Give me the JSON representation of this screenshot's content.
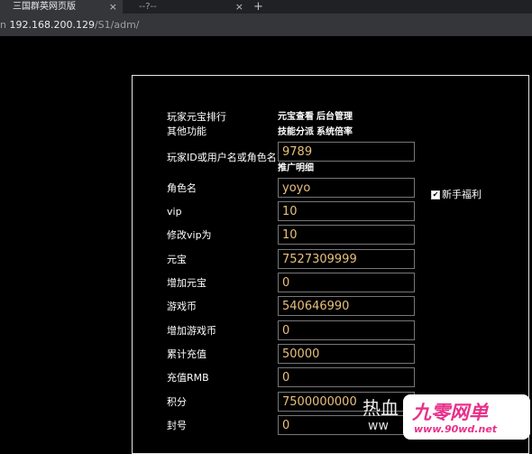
{
  "tabs": [
    {
      "label": "三国群英网页版",
      "close": "×"
    },
    {
      "label": "--?--",
      "close": "×"
    }
  ],
  "new_tab": "+",
  "address": {
    "scheme": "n",
    "host": "192.168.200.129",
    "path": "/S1/adm/"
  },
  "links": {
    "yuanbao_view": "元宝查看",
    "admin": "后台管理",
    "skill_dist": "技能分派",
    "system_rate": "系统倍率",
    "promo_detail": "推广明细"
  },
  "labels": {
    "ranking": "玩家元宝排行",
    "other": "其他功能",
    "player_id": "玩家ID或用户名或角色名",
    "role_name": "角色名",
    "vip": "vip",
    "modify_vip": "修改vip为",
    "yuanbao": "元宝",
    "add_yuanbao": "增加元宝",
    "coins": "游戏币",
    "add_coins": "增加游戏币",
    "total_recharge": "累计充值",
    "recharge_rmb": "充值RMB",
    "points": "积分",
    "ban": "封号"
  },
  "values": {
    "player_id": "9789",
    "role_name": "yoyo",
    "vip": "10",
    "modify_vip": "10",
    "yuanbao": "7527309999",
    "add_yuanbao": "0",
    "coins": "540646990",
    "add_coins": "0",
    "total_recharge": "50000",
    "recharge_rmb": "0",
    "points": "7500000000",
    "ban": "0"
  },
  "newbie": {
    "label": "新手福利",
    "checked": true,
    "check_glyph": "✔"
  },
  "watermark": {
    "text1": "热血",
    "text2": "ww",
    "logo_big": "九零网单",
    "logo_small": "www.90wd.net"
  }
}
